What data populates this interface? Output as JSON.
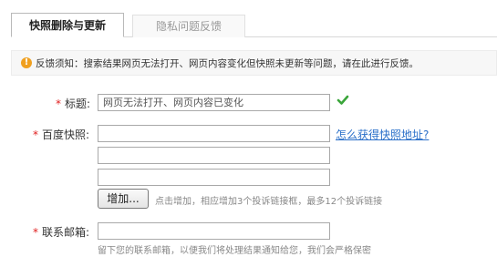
{
  "tabs": [
    {
      "label": "快照删除与更新",
      "active": true
    },
    {
      "label": "隐私问题反馈",
      "active": false
    }
  ],
  "notice": {
    "icon": "exclamation-icon",
    "text": "反馈须知：搜索结果网页无法打开、网页内容变化但快照未更新等问题，请在此进行反馈。"
  },
  "form": {
    "required_mark": "*",
    "title_label": "标题:",
    "title_value": "网页无法打开、网页内容已变化",
    "snapshot_label": "百度快照:",
    "snapshot_value_1": "",
    "snapshot_value_2": "",
    "snapshot_value_3": "",
    "snapshot_help_link": "怎么获得快照地址?",
    "add_button": "增加...",
    "add_hint": "点击增加，相应增加3个投诉链接框，最多12个投诉链接",
    "email_label": "联系邮箱:",
    "email_value": "",
    "email_hint": "留下您的联系邮箱，以便我们将处理结果通知给您，我们会严格保密"
  },
  "colors": {
    "accent_link": "#2a6fc9",
    "required": "#e02020",
    "valid_check": "#3aa53a",
    "notice_icon": "#f0a020"
  }
}
